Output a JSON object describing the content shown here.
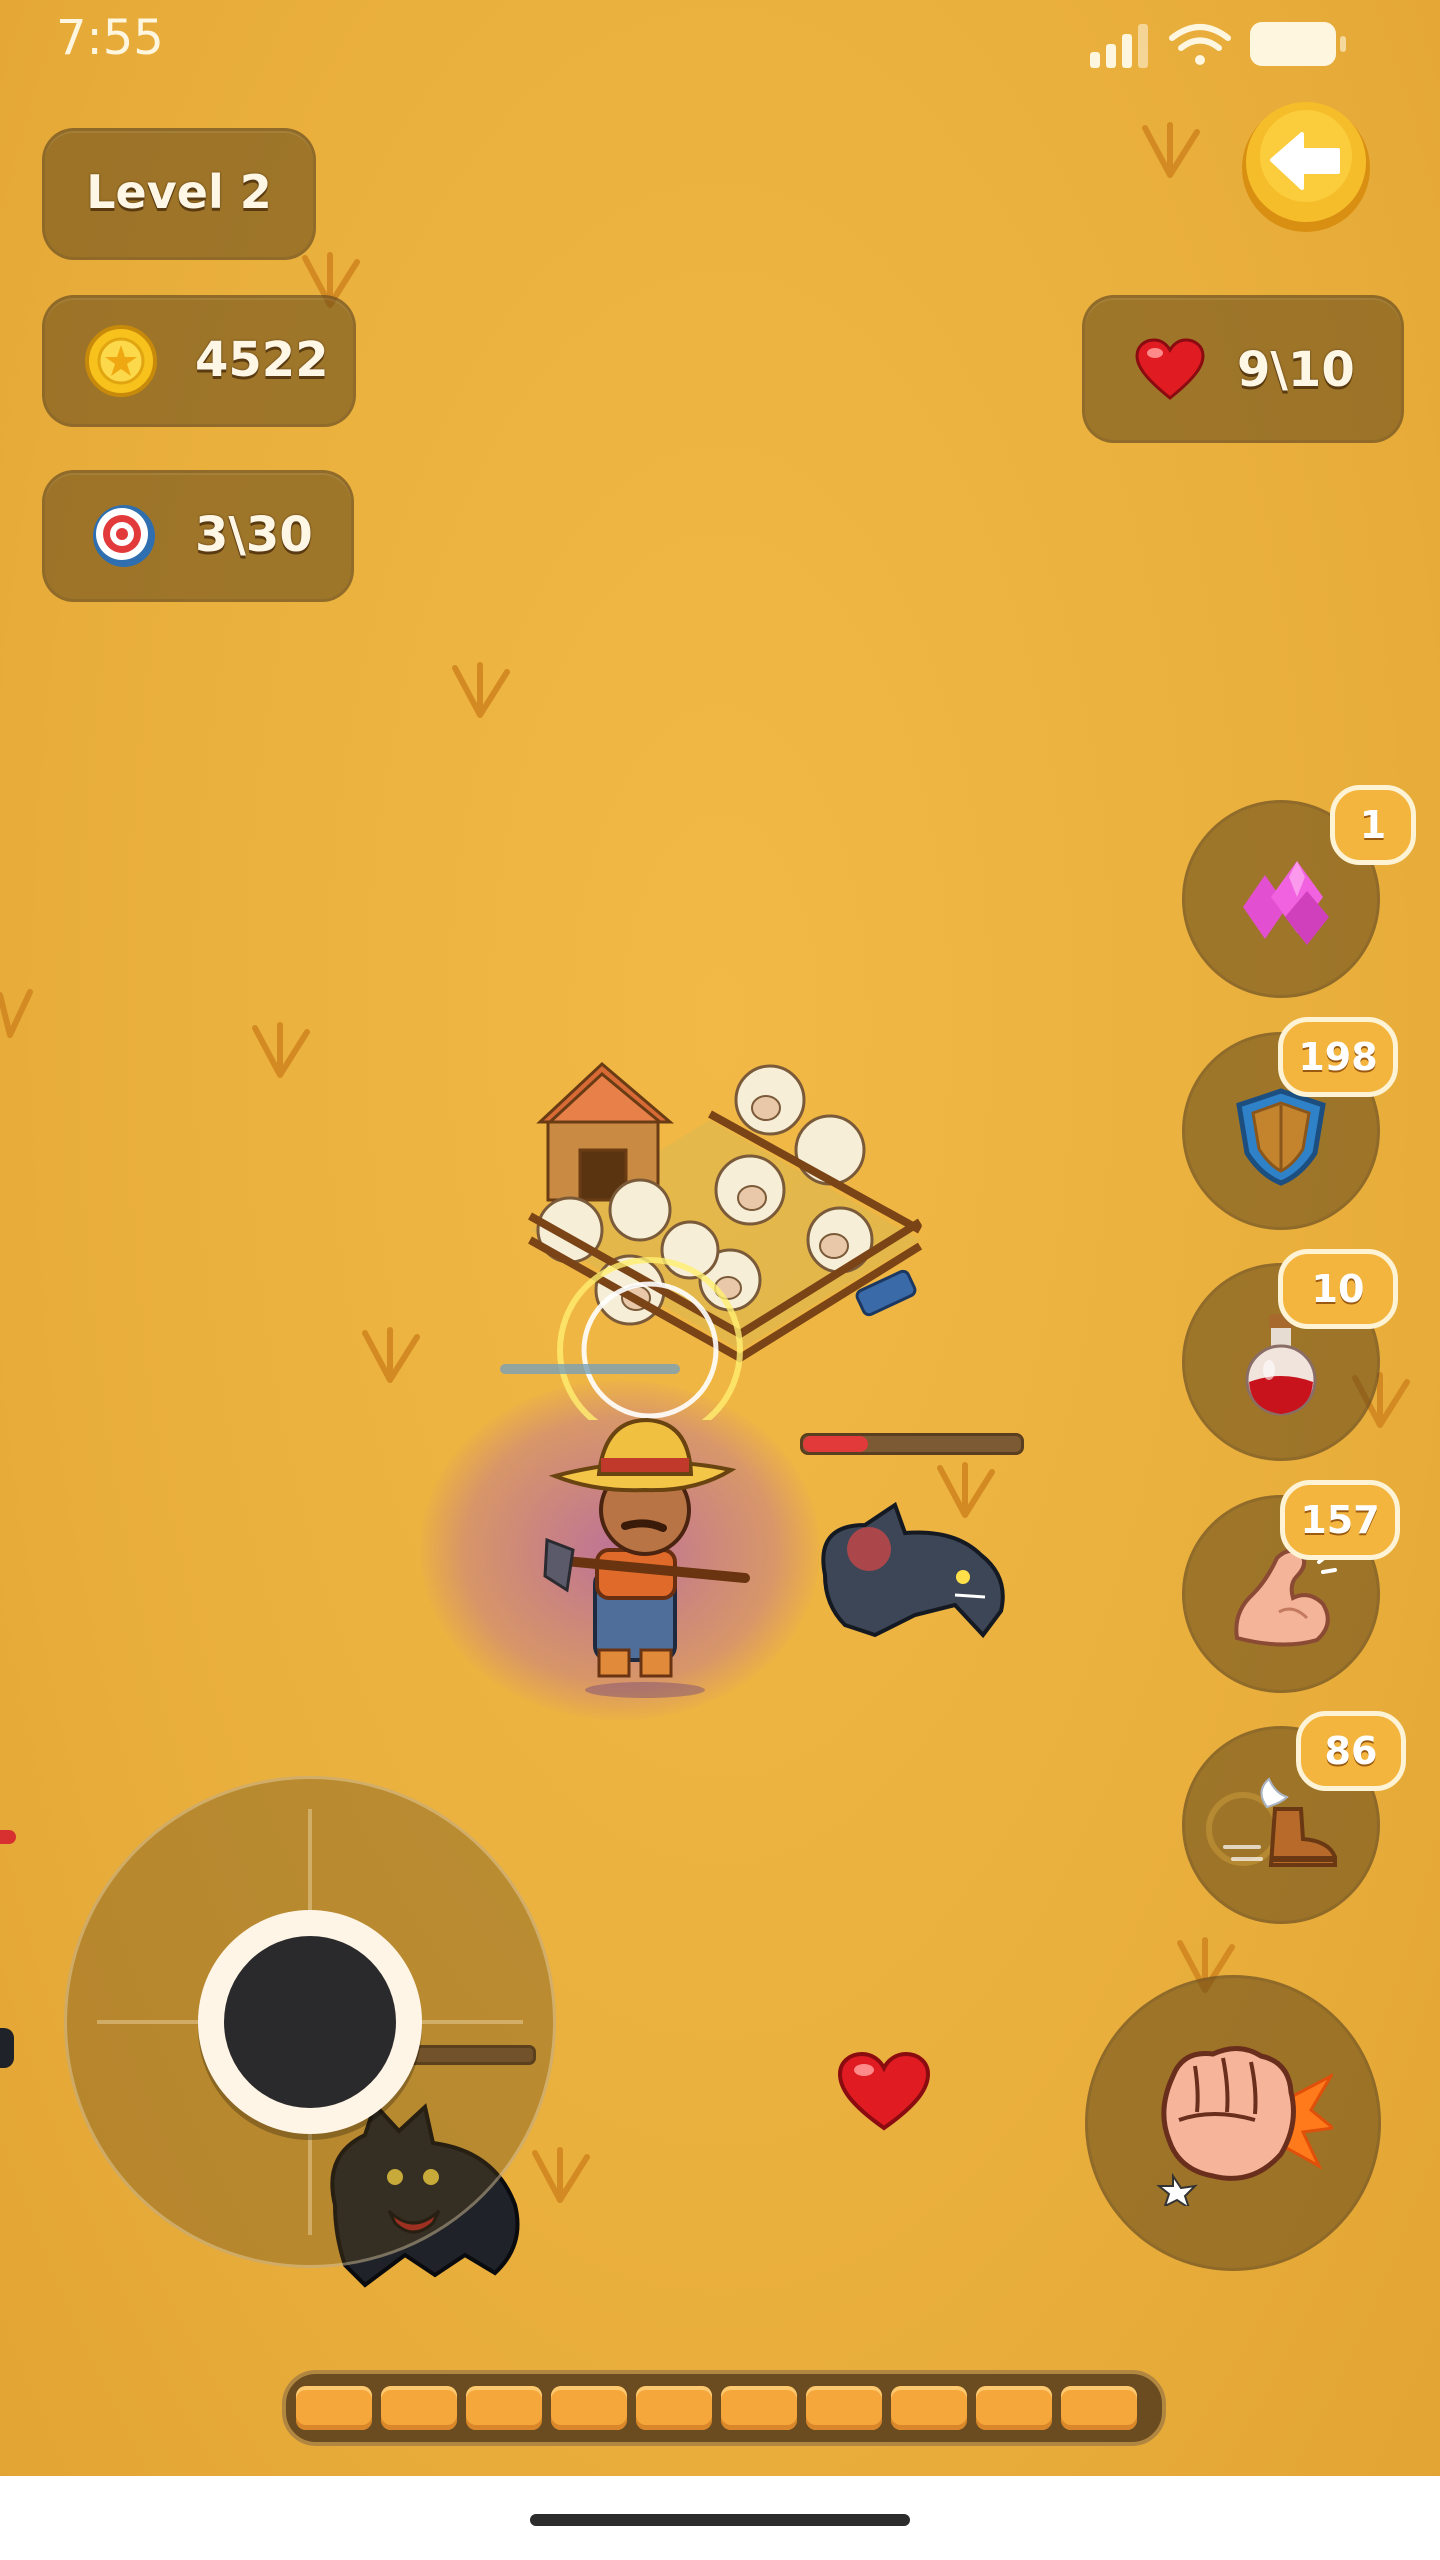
{
  "status_bar": {
    "time": "7:55"
  },
  "hud": {
    "level_label": "Level 2",
    "coins": "4522",
    "targets": "3\\30",
    "health": "9\\10"
  },
  "powerups": [
    {
      "name": "gems",
      "count": "1"
    },
    {
      "name": "shield",
      "count": "198"
    },
    {
      "name": "potion",
      "count": "10"
    },
    {
      "name": "strength",
      "count": "157"
    },
    {
      "name": "speed-boots",
      "count": "86"
    }
  ],
  "progress": {
    "segments_filled": 10,
    "segments_total": 10
  },
  "colors": {
    "ground": "#eab03d",
    "panel": "#5f4619",
    "badge": "#f4b53e",
    "progress_fill": "#f5a73b"
  }
}
